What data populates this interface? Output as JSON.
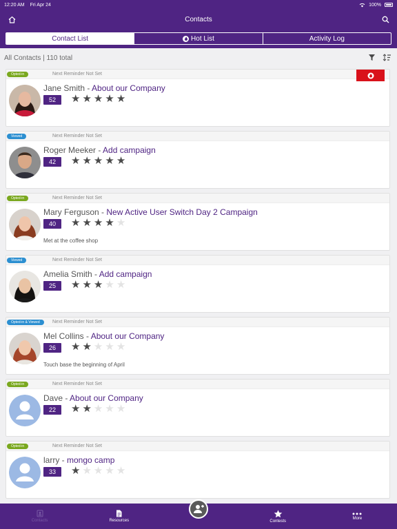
{
  "status": {
    "time": "12:20 AM",
    "date": "Fri Apr 24",
    "battery": "100%"
  },
  "header": {
    "title": "Contacts"
  },
  "segments": [
    {
      "label": "Contact List",
      "active": true
    },
    {
      "label": "Hot List",
      "active": false
    },
    {
      "label": "Activity Log",
      "active": false
    }
  ],
  "filter": {
    "summary": "All Contacts | 110 total"
  },
  "contacts": [
    {
      "badge": "Opted-in",
      "badge_color": "#7aa81f",
      "reminder": "Next Reminder Not Set",
      "name": "Jane Smith",
      "separator": "-",
      "campaign": "About our Company",
      "score": "52",
      "stars": 5,
      "note": "",
      "hot": true,
      "avatar": "photo-woman-dark-hair"
    },
    {
      "badge": "Viewed",
      "badge_color": "#2c8fd1",
      "reminder": "Next Reminder Not Set",
      "name": "Roger Meeker",
      "separator": "-",
      "campaign": "Add campaign",
      "score": "42",
      "stars": 5,
      "note": "",
      "hot": false,
      "avatar": "photo-man"
    },
    {
      "badge": "Opted-in",
      "badge_color": "#7aa81f",
      "reminder": "Next Reminder Not Set",
      "name": "Mary Ferguson",
      "separator": "-",
      "campaign": "New  Active User Switch Day 2 Campaign",
      "score": "40",
      "stars": 4,
      "note": "Met at the coffee shop",
      "hot": false,
      "avatar": "photo-woman-auburn"
    },
    {
      "badge": "Viewed",
      "badge_color": "#2c8fd1",
      "reminder": "Next Reminder Not Set",
      "name": "Amelia Smith",
      "separator": "-",
      "campaign": "Add campaign",
      "score": "25",
      "stars": 3,
      "note": "",
      "hot": false,
      "avatar": "photo-woman-black-hair"
    },
    {
      "badge": "Opted-in & Viewed",
      "badge_color": "#2c8fd1",
      "reminder": "Next Reminder Not Set",
      "name": "Mel Collins",
      "separator": "-",
      "campaign": "About our Company",
      "score": "26",
      "stars": 2,
      "note": "Touch base the beginning of April",
      "hot": false,
      "avatar": "photo-woman-red-hair"
    },
    {
      "badge": "Opted-in",
      "badge_color": "#7aa81f",
      "reminder": "Next Reminder Not Set",
      "name": "Dave ",
      "separator": "-",
      "campaign": "About our Company",
      "score": "22",
      "stars": 2,
      "note": "",
      "hot": false,
      "avatar": "placeholder-person"
    },
    {
      "badge": "Opted-in",
      "badge_color": "#7aa81f",
      "reminder": "Next Reminder Not Set",
      "name": "larry ",
      "separator": "-",
      "campaign": "mongo camp",
      "score": "33",
      "stars": 1,
      "note": "",
      "hot": false,
      "avatar": "placeholder-person"
    }
  ],
  "tabbar": {
    "items": [
      {
        "label": "Contacts",
        "icon": "contacts-icon",
        "dim": true
      },
      {
        "label": "Resources",
        "icon": "document-icon",
        "dim": false
      },
      {
        "label": "",
        "icon": "add-contact-icon",
        "dim": false
      },
      {
        "label": "Contests",
        "icon": "star-icon",
        "dim": false
      },
      {
        "label": "More",
        "icon": "more-icon",
        "dim": false
      }
    ]
  }
}
